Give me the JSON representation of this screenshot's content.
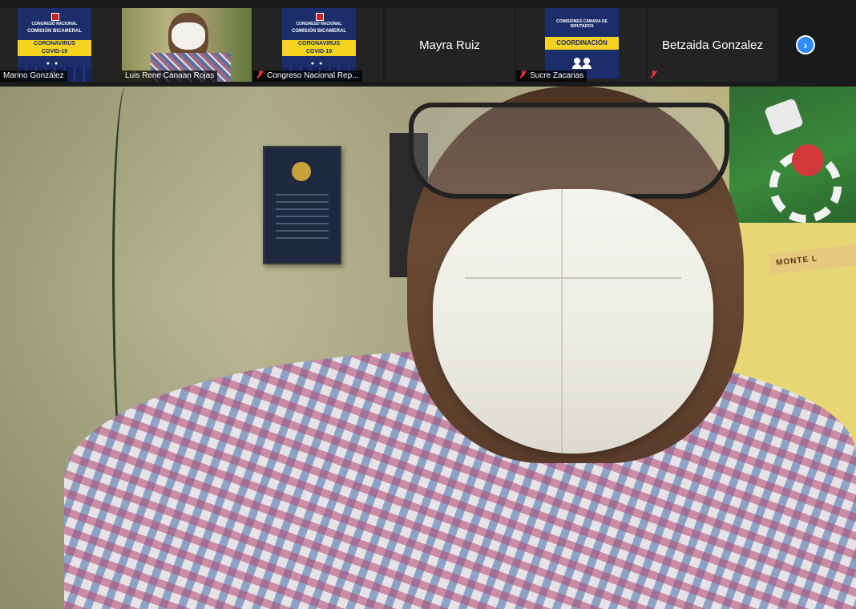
{
  "thumbnails": [
    {
      "name": "Marino González",
      "type": "card",
      "card_top": "CONGRESO NACIONAL",
      "card_mid": "COMISIÓN BICAMERAL",
      "card_title_1": "CORONAVIRUS",
      "card_title_2": "COVID-19",
      "muted": false
    },
    {
      "name": "Luis Rene Canaan Rojas",
      "type": "camera",
      "active": true,
      "muted": false
    },
    {
      "name": "Congreso Nacional Rep...",
      "type": "card",
      "card_top": "CONGRESO NACIONAL",
      "card_mid": "COMISIÓN BICAMERAL",
      "card_title_1": "CORONAVIRUS",
      "card_title_2": "COVID-19",
      "muted": true
    },
    {
      "name": "Mayra Ruiz",
      "type": "name_only",
      "muted": false
    },
    {
      "name": "Sucre Zacarias",
      "type": "coord",
      "card_top": "COMISIONES CÁMARA DE DIPUTADOS",
      "card_title": "COORDINACIÓN",
      "muted": true
    },
    {
      "name": "Betzaida Gonzalez",
      "type": "name_only",
      "muted": true
    }
  ],
  "next_button": {
    "icon": "chevron-right-icon",
    "glyph": "›"
  },
  "main_video": {
    "sign_text": "MONTE L"
  },
  "colors": {
    "active_border": "#c7e23b",
    "accent": "#2d8cff",
    "muted": "#e33333",
    "card_blue": "#1c2d6b",
    "card_yellow": "#f5d21d"
  }
}
